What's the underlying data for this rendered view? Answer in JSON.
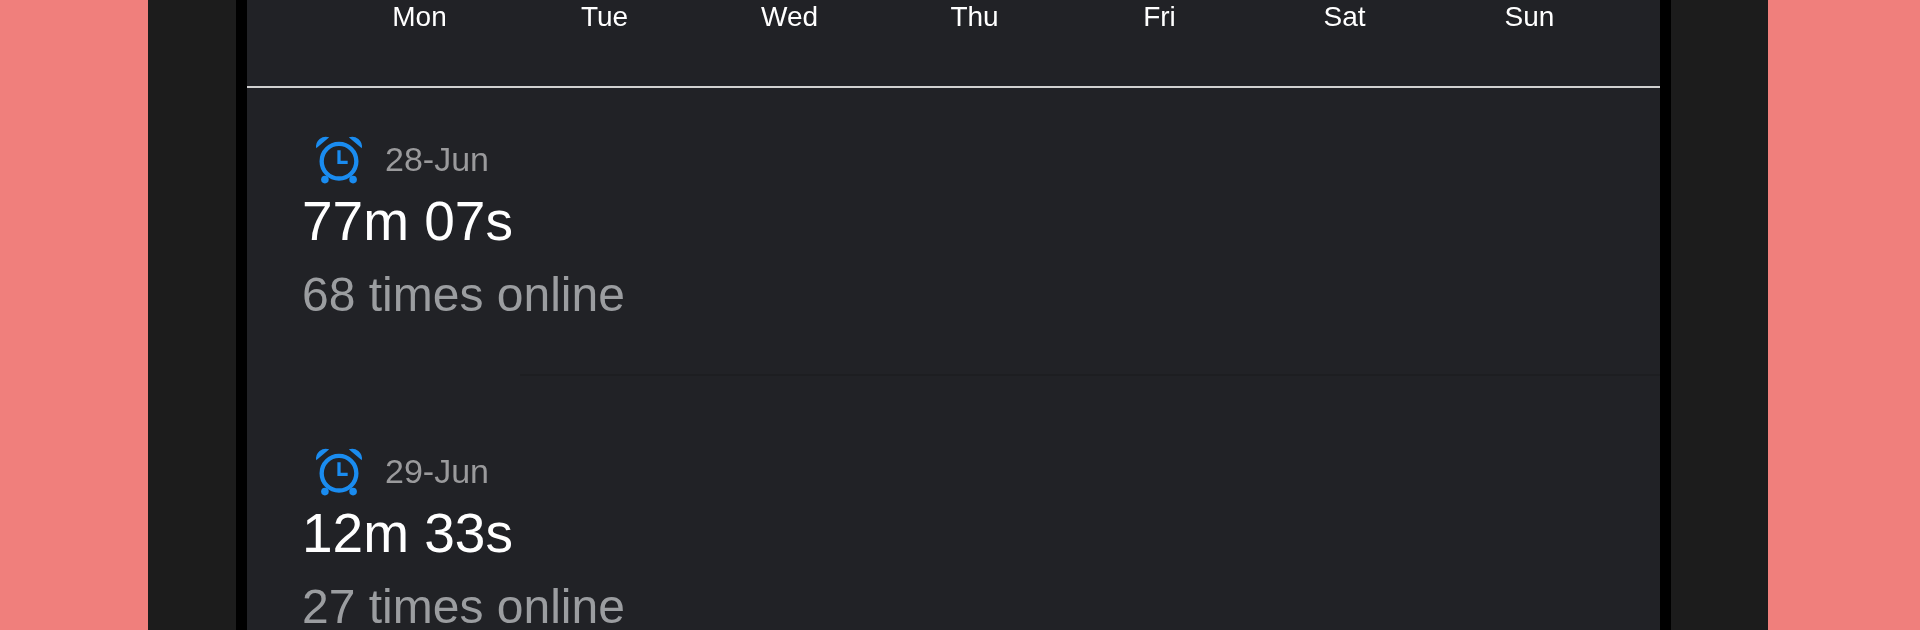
{
  "weekdays": [
    "Mon",
    "Tue",
    "Wed",
    "Thu",
    "Fri",
    "Sat",
    "Sun"
  ],
  "sessions": [
    {
      "date": "28-Jun",
      "duration": "77m 07s",
      "times_online": "68 times online"
    },
    {
      "date": "29-Jun",
      "duration": "12m 33s",
      "times_online": "27 times online"
    }
  ]
}
